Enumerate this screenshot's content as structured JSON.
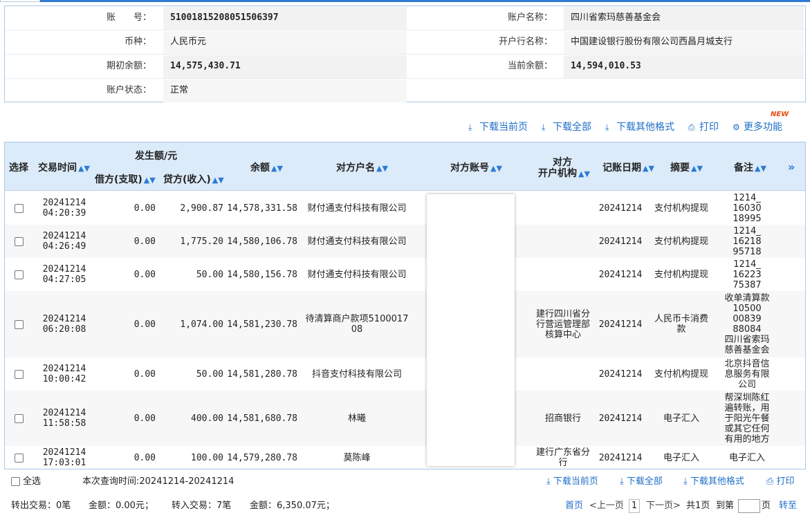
{
  "account_info": {
    "account_no_label": "账　　号：",
    "account_no": "51001815208051506397",
    "account_name_label": "账户名称：",
    "account_name": "四川省索玛慈善基金会",
    "currency_label": "币种：",
    "currency": "人民币元",
    "bank_label": "开户行名称：",
    "bank": "中国建设银行股份有限公司西昌月城支行",
    "opening_balance_label": "期初余额：",
    "opening_balance": "14,575,430.71",
    "current_balance_label": "当前余额：",
    "current_balance": "14,594,010.53",
    "status_label": "账户状态：",
    "status": "正常"
  },
  "toolbar": {
    "download_page": "下载当前页",
    "download_all": "下载全部",
    "download_other": "下载其他格式",
    "print": "打印",
    "more": "更多功能",
    "new_badge": "NEW"
  },
  "table": {
    "headers": {
      "select": "选择",
      "time": "交易时间",
      "amount_group": "发生额/元",
      "debit": "借方(支取)",
      "credit": "贷方(收入)",
      "balance": "余额",
      "counterparty_name": "对方户名",
      "counterparty_account": "对方账号",
      "counterparty_bank_line1": "对方",
      "counterparty_bank_line2": "开户机构",
      "booking_date": "记账日期",
      "summary": "摘要",
      "remark": "备注"
    },
    "rows": [
      {
        "time1": "20241214",
        "time2": "04:20:39",
        "debit": "0.00",
        "credit": "2,900.87",
        "balance": "14,578,331.58",
        "name": "财付通支付科技有限公司",
        "bank": "",
        "date": "20241214",
        "summary": "支付机构提现",
        "remark": "1214_\n16030\n18995"
      },
      {
        "time1": "20241214",
        "time2": "04:26:49",
        "debit": "0.00",
        "credit": "1,775.20",
        "balance": "14,580,106.78",
        "name": "财付通支付科技有限公司",
        "bank": "",
        "date": "20241214",
        "summary": "支付机构提现",
        "remark": "1214_\n16218\n95718"
      },
      {
        "time1": "20241214",
        "time2": "04:27:05",
        "debit": "0.00",
        "credit": "50.00",
        "balance": "14,580,156.78",
        "name": "财付通支付科技有限公司",
        "bank": "",
        "date": "20241214",
        "summary": "支付机构提现",
        "remark": "1214_\n16223\n75387"
      },
      {
        "time1": "20241214",
        "time2": "06:20:08",
        "debit": "0.00",
        "credit": "1,074.00",
        "balance": "14,581,230.78",
        "name": "待清算商户款项510001708",
        "bank": "建行四川省分行营运管理部核算中心",
        "date": "20241214",
        "summary": "人民币卡消费款",
        "remark": "收单清算款\n10500\n00839\n88084\n四川省索玛\n慈善基金会"
      },
      {
        "time1": "20241214",
        "time2": "10:00:42",
        "debit": "0.00",
        "credit": "50.00",
        "balance": "14,581,280.78",
        "name": "抖音支付科技有限公司",
        "bank": "",
        "date": "20241214",
        "summary": "支付机构提现",
        "remark": "北京抖音信\n息服务有限\n公司"
      },
      {
        "time1": "20241214",
        "time2": "11:58:58",
        "debit": "0.00",
        "credit": "400.00",
        "balance": "14,581,680.78",
        "name": "林曦",
        "bank": "招商银行",
        "date": "20241214",
        "summary": "电子汇入",
        "remark": "帮深圳陈红\n遍转账，用\n于阳光午餐\n或其它任何\n有用的地方"
      },
      {
        "time1": "20241214",
        "time2": "17:03:01",
        "debit": "0.00",
        "credit": "100.00",
        "balance": "14,579,280.78",
        "name": "莫陈峰",
        "bank": "建行广东省分行",
        "date": "20241214",
        "summary": "电子汇入",
        "remark": "电子汇入"
      }
    ]
  },
  "footer": {
    "select_all": "全选",
    "query_range": "本次查询时间:20241214-20241214",
    "download_page": "下载当前页",
    "download_all": "下载全部",
    "download_other": "下载其他格式",
    "print": "打印",
    "summary_out": "转出交易：0笔",
    "summary_out_amount": "金额：0.00元；",
    "summary_in": "转入交易：7笔",
    "summary_in_amount": "金额：6,350.07元；",
    "first_page": "首页",
    "prev_page": "<上一页",
    "current_page": "1",
    "next_page": "下一页>",
    "total_pages": "共1页",
    "goto_label": "到第",
    "page_unit": "页",
    "goto_button": "转至"
  }
}
